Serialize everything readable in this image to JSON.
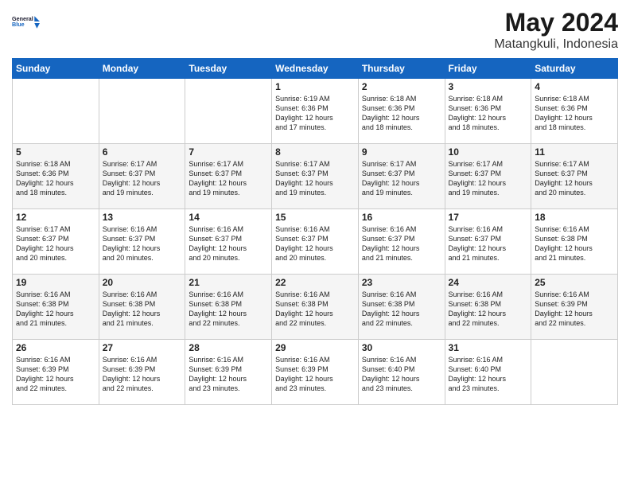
{
  "header": {
    "logo_line1": "General",
    "logo_line2": "Blue",
    "title": "May 2024",
    "subtitle": "Matangkuli, Indonesia"
  },
  "days_of_week": [
    "Sunday",
    "Monday",
    "Tuesday",
    "Wednesday",
    "Thursday",
    "Friday",
    "Saturday"
  ],
  "weeks": [
    [
      {
        "day": "",
        "info": ""
      },
      {
        "day": "",
        "info": ""
      },
      {
        "day": "",
        "info": ""
      },
      {
        "day": "1",
        "info": "Sunrise: 6:19 AM\nSunset: 6:36 PM\nDaylight: 12 hours\nand 17 minutes."
      },
      {
        "day": "2",
        "info": "Sunrise: 6:18 AM\nSunset: 6:36 PM\nDaylight: 12 hours\nand 18 minutes."
      },
      {
        "day": "3",
        "info": "Sunrise: 6:18 AM\nSunset: 6:36 PM\nDaylight: 12 hours\nand 18 minutes."
      },
      {
        "day": "4",
        "info": "Sunrise: 6:18 AM\nSunset: 6:36 PM\nDaylight: 12 hours\nand 18 minutes."
      }
    ],
    [
      {
        "day": "5",
        "info": "Sunrise: 6:18 AM\nSunset: 6:36 PM\nDaylight: 12 hours\nand 18 minutes."
      },
      {
        "day": "6",
        "info": "Sunrise: 6:17 AM\nSunset: 6:37 PM\nDaylight: 12 hours\nand 19 minutes."
      },
      {
        "day": "7",
        "info": "Sunrise: 6:17 AM\nSunset: 6:37 PM\nDaylight: 12 hours\nand 19 minutes."
      },
      {
        "day": "8",
        "info": "Sunrise: 6:17 AM\nSunset: 6:37 PM\nDaylight: 12 hours\nand 19 minutes."
      },
      {
        "day": "9",
        "info": "Sunrise: 6:17 AM\nSunset: 6:37 PM\nDaylight: 12 hours\nand 19 minutes."
      },
      {
        "day": "10",
        "info": "Sunrise: 6:17 AM\nSunset: 6:37 PM\nDaylight: 12 hours\nand 19 minutes."
      },
      {
        "day": "11",
        "info": "Sunrise: 6:17 AM\nSunset: 6:37 PM\nDaylight: 12 hours\nand 20 minutes."
      }
    ],
    [
      {
        "day": "12",
        "info": "Sunrise: 6:17 AM\nSunset: 6:37 PM\nDaylight: 12 hours\nand 20 minutes."
      },
      {
        "day": "13",
        "info": "Sunrise: 6:16 AM\nSunset: 6:37 PM\nDaylight: 12 hours\nand 20 minutes."
      },
      {
        "day": "14",
        "info": "Sunrise: 6:16 AM\nSunset: 6:37 PM\nDaylight: 12 hours\nand 20 minutes."
      },
      {
        "day": "15",
        "info": "Sunrise: 6:16 AM\nSunset: 6:37 PM\nDaylight: 12 hours\nand 20 minutes."
      },
      {
        "day": "16",
        "info": "Sunrise: 6:16 AM\nSunset: 6:37 PM\nDaylight: 12 hours\nand 21 minutes."
      },
      {
        "day": "17",
        "info": "Sunrise: 6:16 AM\nSunset: 6:37 PM\nDaylight: 12 hours\nand 21 minutes."
      },
      {
        "day": "18",
        "info": "Sunrise: 6:16 AM\nSunset: 6:38 PM\nDaylight: 12 hours\nand 21 minutes."
      }
    ],
    [
      {
        "day": "19",
        "info": "Sunrise: 6:16 AM\nSunset: 6:38 PM\nDaylight: 12 hours\nand 21 minutes."
      },
      {
        "day": "20",
        "info": "Sunrise: 6:16 AM\nSunset: 6:38 PM\nDaylight: 12 hours\nand 21 minutes."
      },
      {
        "day": "21",
        "info": "Sunrise: 6:16 AM\nSunset: 6:38 PM\nDaylight: 12 hours\nand 22 minutes."
      },
      {
        "day": "22",
        "info": "Sunrise: 6:16 AM\nSunset: 6:38 PM\nDaylight: 12 hours\nand 22 minutes."
      },
      {
        "day": "23",
        "info": "Sunrise: 6:16 AM\nSunset: 6:38 PM\nDaylight: 12 hours\nand 22 minutes."
      },
      {
        "day": "24",
        "info": "Sunrise: 6:16 AM\nSunset: 6:38 PM\nDaylight: 12 hours\nand 22 minutes."
      },
      {
        "day": "25",
        "info": "Sunrise: 6:16 AM\nSunset: 6:39 PM\nDaylight: 12 hours\nand 22 minutes."
      }
    ],
    [
      {
        "day": "26",
        "info": "Sunrise: 6:16 AM\nSunset: 6:39 PM\nDaylight: 12 hours\nand 22 minutes."
      },
      {
        "day": "27",
        "info": "Sunrise: 6:16 AM\nSunset: 6:39 PM\nDaylight: 12 hours\nand 22 minutes."
      },
      {
        "day": "28",
        "info": "Sunrise: 6:16 AM\nSunset: 6:39 PM\nDaylight: 12 hours\nand 23 minutes."
      },
      {
        "day": "29",
        "info": "Sunrise: 6:16 AM\nSunset: 6:39 PM\nDaylight: 12 hours\nand 23 minutes."
      },
      {
        "day": "30",
        "info": "Sunrise: 6:16 AM\nSunset: 6:40 PM\nDaylight: 12 hours\nand 23 minutes."
      },
      {
        "day": "31",
        "info": "Sunrise: 6:16 AM\nSunset: 6:40 PM\nDaylight: 12 hours\nand 23 minutes."
      },
      {
        "day": "",
        "info": ""
      }
    ]
  ]
}
